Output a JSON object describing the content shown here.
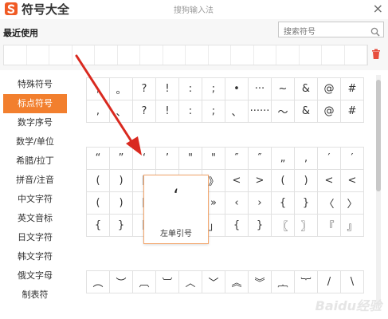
{
  "app": {
    "title": "符号大全",
    "window_title": "搜狗输入法",
    "close_glyph": "×"
  },
  "recent": {
    "label": "最近使用"
  },
  "search": {
    "placeholder": "搜索符号"
  },
  "sidebar": {
    "items": [
      {
        "label": "特殊符号"
      },
      {
        "label": "标点符号"
      },
      {
        "label": "数字序号"
      },
      {
        "label": "数学/单位"
      },
      {
        "label": "希腊/拉丁"
      },
      {
        "label": "拼音/注音"
      },
      {
        "label": "中文字符"
      },
      {
        "label": "英文音标"
      },
      {
        "label": "日文字符"
      },
      {
        "label": "韩文字符"
      },
      {
        "label": "俄文字母"
      },
      {
        "label": "制表符"
      }
    ]
  },
  "grid1": {
    "rows": [
      [
        ",",
        "。",
        "?",
        "!",
        ":",
        ";",
        "•",
        "···",
        "~",
        "&",
        "@",
        "#"
      ],
      [
        ",",
        "、",
        "?",
        "!",
        ":",
        ";",
        "、",
        "······",
        "～",
        "&",
        "@",
        "#"
      ]
    ]
  },
  "grid2": {
    "rows": [
      [
        "“",
        "”",
        "‘",
        "’",
        "\"",
        "\"",
        "″",
        "″",
        "„",
        "‚",
        "′",
        "′"
      ],
      [
        "(",
        ")",
        "[",
        "]",
        "《",
        "》",
        "<",
        ">",
        "(",
        ")",
        "<",
        "<"
      ],
      [
        "(",
        ")",
        "[",
        "]",
        "«",
        "»",
        "‹",
        "›",
        "{",
        "}",
        "〈",
        "〉"
      ],
      [
        "{",
        "}",
        "[",
        "]",
        "「",
        "」",
        "{",
        "}",
        "〖",
        "〗",
        "『",
        "』"
      ]
    ]
  },
  "grid3": {
    "rows": [
      [
        "︵",
        "︶",
        "︹",
        "︺",
        "︿",
        "﹀",
        "︽",
        "︾",
        "︷",
        "︸",
        "/",
        "\\"
      ]
    ]
  },
  "tooltip": {
    "glyph": "‘",
    "name": "左单引号"
  },
  "watermark": "Baidu经验",
  "colors": {
    "accent": "#f27f2e",
    "arrow": "#d9291f"
  },
  "icons": {
    "logo": "sogou-logo",
    "search": "search-icon",
    "trash": "trash-icon",
    "close": "close-icon"
  }
}
